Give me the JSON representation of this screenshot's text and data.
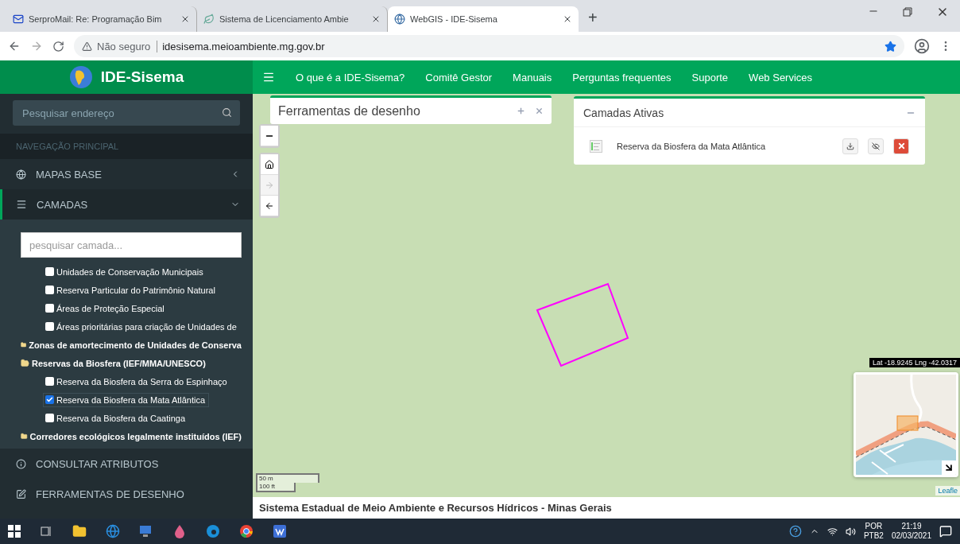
{
  "browser": {
    "tabs": [
      {
        "title": "SerproMail: Re: Programação Bim",
        "selected": false
      },
      {
        "title": "Sistema de Licenciamento Ambie",
        "selected": false
      },
      {
        "title": "WebGIS - IDE-Sisema",
        "selected": true
      }
    ],
    "new_tab": "+",
    "security": "Não seguro",
    "url": "idesisema.meioambiente.mg.gov.br"
  },
  "app": {
    "logo": "IDE-Sisema",
    "nav": [
      "O que é a IDE-Sisema?",
      "Comitê Gestor",
      "Manuais",
      "Perguntas frequentes",
      "Suporte",
      "Web Services"
    ]
  },
  "sidebar": {
    "search": {
      "placeholder": "Pesquisar endereço"
    },
    "section": "NAVEGAÇÃO PRINCIPAL",
    "menu": [
      {
        "label": "MAPAS BASE",
        "expanded": false
      },
      {
        "label": "CAMADAS",
        "expanded": true
      }
    ],
    "layer_search": {
      "placeholder": "pesquisar camada..."
    },
    "tree": [
      {
        "kind": "continuation",
        "children": [
          {
            "kind": "layer",
            "label": "Unidades de Conservação Municipais",
            "checked": false,
            "selected": false
          },
          {
            "kind": "layer",
            "label": "Reserva Particular do Patrimônio Natural",
            "checked": false,
            "selected": false
          },
          {
            "kind": "layer",
            "label": "Áreas de Proteção Especial",
            "checked": false,
            "selected": false
          },
          {
            "kind": "layer",
            "label": "Áreas prioritárias para criação de Unidades de",
            "checked": false,
            "selected": false
          }
        ]
      },
      {
        "kind": "group",
        "label": "Zonas de amortecimento de Unidades de Conserva",
        "expanded": false
      },
      {
        "kind": "group",
        "label": "Reservas da Biosfera (IEF/MMA/UNESCO)",
        "expanded": true,
        "children": [
          {
            "kind": "layer",
            "label": "Reserva da Biosfera da Serra do Espinhaço",
            "checked": false,
            "selected": false
          },
          {
            "kind": "layer",
            "label": "Reserva da Biosfera da Mata Atlântica",
            "checked": true,
            "selected": true
          },
          {
            "kind": "layer",
            "label": "Reserva da Biosfera da Caatinga",
            "checked": false,
            "selected": false
          }
        ]
      },
      {
        "kind": "group",
        "label": "Corredores ecológicos legalmente instituídos (IEF)",
        "expanded": false
      }
    ],
    "bottom_menu": [
      {
        "label": "CONSULTAR ATRIBUTOS"
      },
      {
        "label": "FERRAMENTAS DE DESENHO"
      }
    ]
  },
  "map": {
    "draw_panel": {
      "title": "Ferramentas de desenho"
    },
    "controls": [
      {
        "disabled": false
      },
      {
        "disabled": true
      },
      {
        "disabled": false
      }
    ],
    "active_layers": {
      "title": "Camadas Ativas",
      "layers": [
        {
          "name": "Reserva da Biosfera da Mata Atlântica"
        }
      ]
    },
    "scale": [
      "50 m",
      "100 ft"
    ],
    "coordinates": "Lat -18.9245 Lng -42.0317",
    "attribution": "Leafle"
  },
  "footer": "Sistema Estadual de Meio Ambiente e Recursos Hídricos - Minas Gerais",
  "taskbar": {
    "language": "POR",
    "layout": "PTB2",
    "time": "21:19",
    "date": "02/03/2021"
  }
}
